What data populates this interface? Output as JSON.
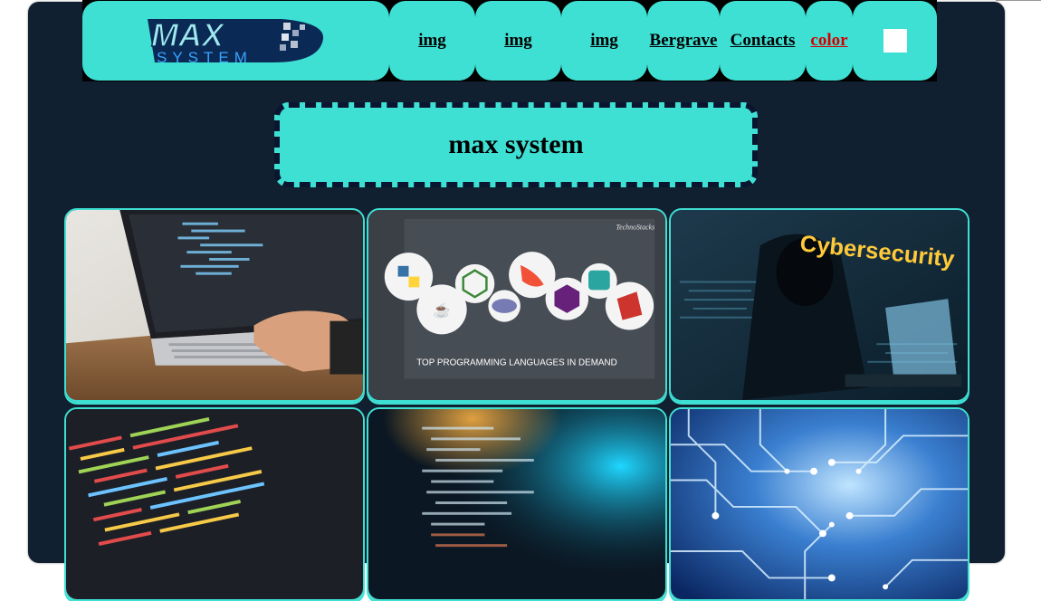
{
  "logo": {
    "wordmark": "MAX",
    "subtitle": "SYSTEM"
  },
  "nav": {
    "items": [
      {
        "label": "img"
      },
      {
        "label": "img"
      },
      {
        "label": "img"
      },
      {
        "label": "Bergrave"
      },
      {
        "label": "Contacts"
      },
      {
        "label": "color"
      }
    ]
  },
  "header": {
    "title": "max system"
  },
  "gallery": {
    "tiles": [
      {
        "subject": "laptop-typing",
        "text": ""
      },
      {
        "subject": "programming-languages",
        "text": "TOP PROGRAMMING LANGUAGES IN DEMAND",
        "badge": "TechnoStacks"
      },
      {
        "subject": "cybersecurity-hacker",
        "text": "Cybersecurity"
      },
      {
        "subject": "code-editor",
        "text": ""
      },
      {
        "subject": "code-blur",
        "text": ""
      },
      {
        "subject": "circuit-board",
        "text": ""
      }
    ]
  },
  "colors": {
    "accent": "#3fe0d4",
    "page_background": "#102030",
    "link_red": "#d20000"
  }
}
